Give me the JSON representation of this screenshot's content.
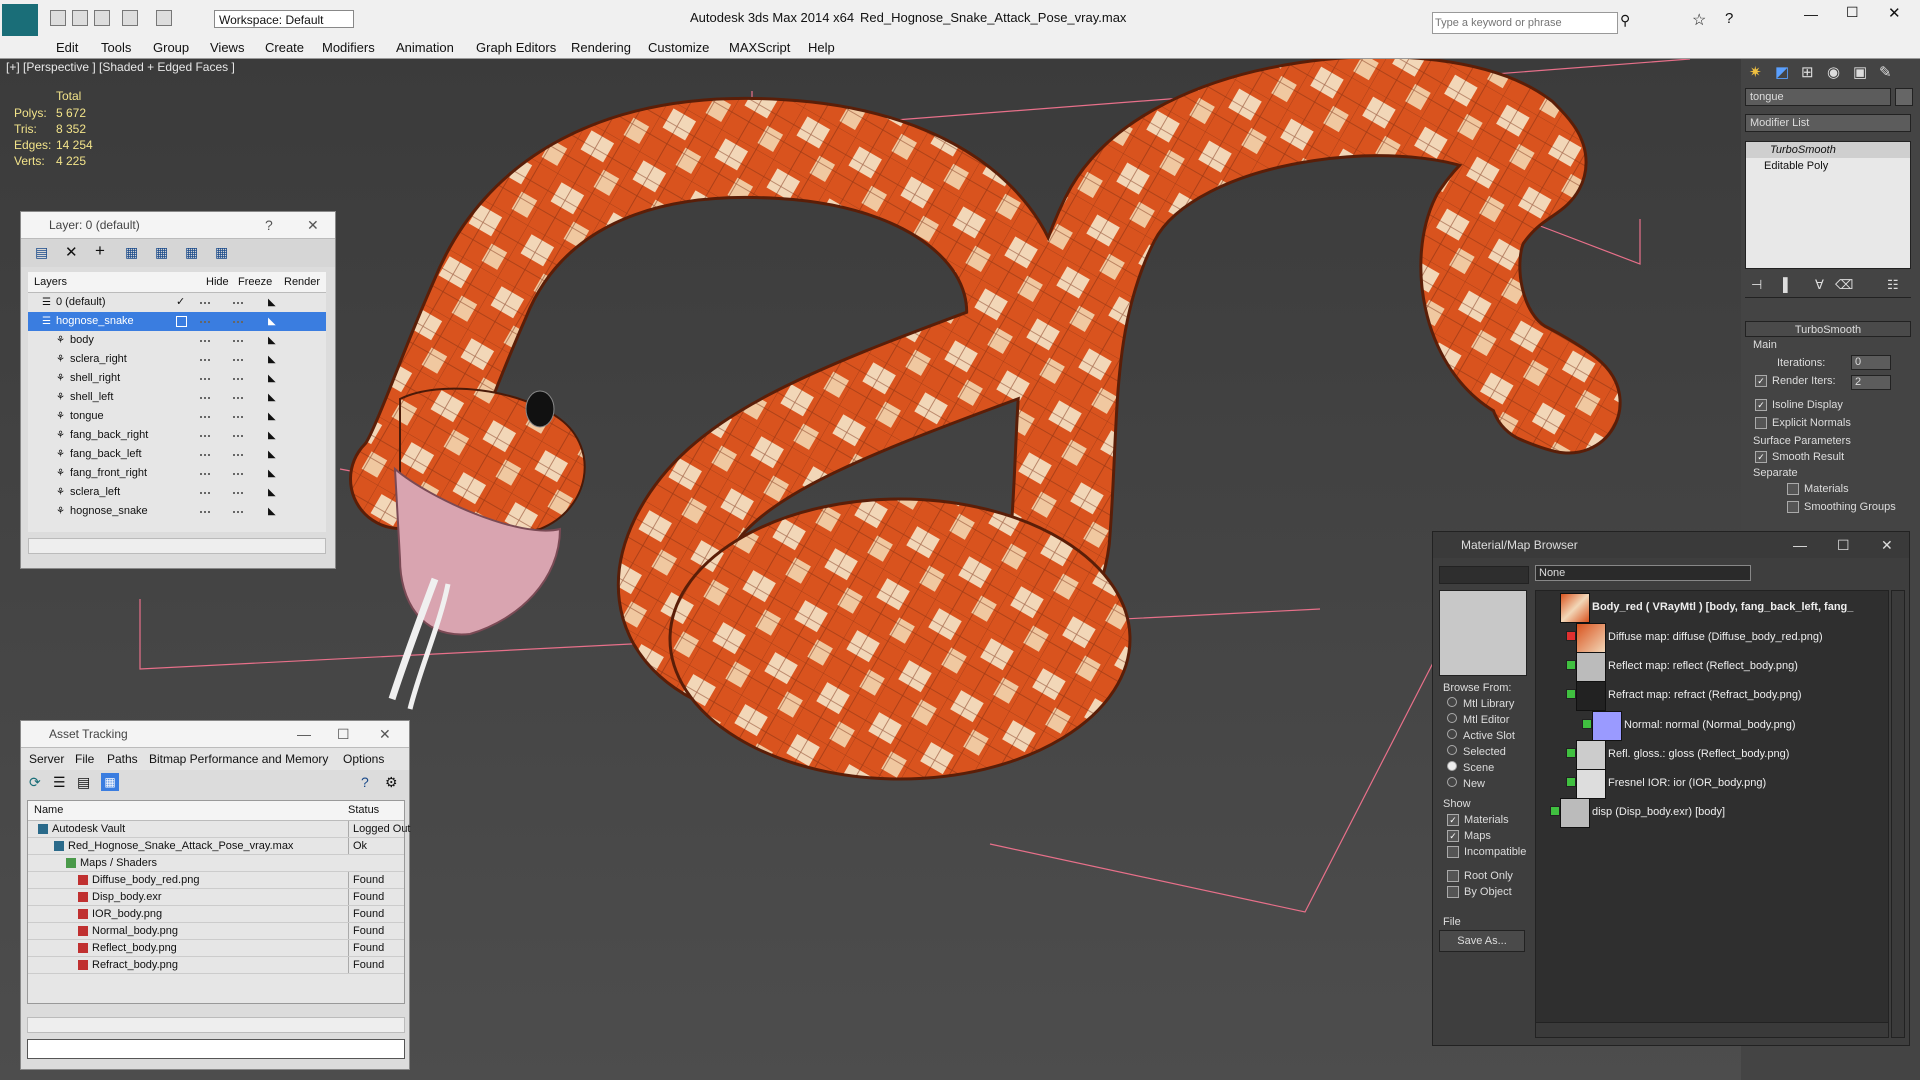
{
  "app": {
    "title": "Autodesk 3ds Max  2014 x64",
    "filename": "Red_Hognose_Snake_Attack_Pose_vray.max",
    "workspace": "Workspace: Default",
    "search_placeholder": "Type a keyword or phrase"
  },
  "menu": [
    "Edit",
    "Tools",
    "Group",
    "Views",
    "Create",
    "Modifiers",
    "Animation",
    "Graph Editors",
    "Rendering",
    "Customize",
    "MAXScript",
    "Help"
  ],
  "viewport": {
    "label": "[+] [Perspective ] [Shaded + Edged Faces ]",
    "stats_header": "Total",
    "stats": [
      {
        "k": "Polys:",
        "v": "5 672"
      },
      {
        "k": "Tris:",
        "v": "8 352"
      },
      {
        "k": "Edges:",
        "v": "14 254"
      },
      {
        "k": "Verts:",
        "v": "4 225"
      }
    ]
  },
  "layers": {
    "title": "Layer: 0 (default)",
    "help": "?",
    "close": "✕",
    "col_layers": "Layers",
    "col_hide": "Hide",
    "col_freeze": "Freeze",
    "col_render": "Render",
    "items": [
      "0 (default)",
      "hognose_snake",
      "body",
      "sclera_right",
      "shell_right",
      "shell_left",
      "tongue",
      "fang_back_right",
      "fang_back_left",
      "fang_front_right",
      "sclera_left",
      "hognose_snake"
    ]
  },
  "asset": {
    "title": "Asset Tracking",
    "menu": [
      "Server",
      "File",
      "Paths",
      "Bitmap Performance and Memory",
      "Options"
    ],
    "col_name": "Name",
    "col_status": "Status",
    "rows": [
      {
        "name": "Autodesk Vault",
        "status": "Logged Out"
      },
      {
        "name": "Red_Hognose_Snake_Attack_Pose_vray.max",
        "status": "Ok"
      },
      {
        "name": "Maps / Shaders",
        "status": ""
      },
      {
        "name": "Diffuse_body_red.png",
        "status": "Found"
      },
      {
        "name": "Disp_body.exr",
        "status": "Found"
      },
      {
        "name": "IOR_body.png",
        "status": "Found"
      },
      {
        "name": "Normal_body.png",
        "status": "Found"
      },
      {
        "name": "Reflect_body.png",
        "status": "Found"
      },
      {
        "name": "Refract_body.png",
        "status": "Found"
      }
    ]
  },
  "cmd": {
    "object_name": "tongue",
    "modifier_list": "Modifier List",
    "stack": [
      "TurboSmooth",
      "Editable Poly"
    ],
    "rollout": "TurboSmooth",
    "main": "Main",
    "iterations_label": "Iterations:",
    "iterations": "0",
    "render_iters_label": "Render Iters:",
    "render_iters": "2",
    "isoline": "Isoline Display",
    "explicit": "Explicit Normals",
    "surface": "Surface Parameters",
    "smooth": "Smooth Result",
    "separate": "Separate",
    "materials": "Materials",
    "smoothing": "Smoothing Groups"
  },
  "mmb": {
    "title": "Material/Map Browser",
    "search": "None",
    "browse_from": "Browse From:",
    "browse": [
      "Mtl Library",
      "Mtl Editor",
      "Active Slot",
      "Selected",
      "Scene",
      "New"
    ],
    "show": "Show",
    "show_items": [
      "Materials",
      "Maps",
      "Incompatible"
    ],
    "root_only": "Root Only",
    "by_object": "By Object",
    "file": "File",
    "save_as": "Save As...",
    "tree": [
      "Body_red  ( VRayMtl )  [body, fang_back_left, fang_",
      "Diffuse map: diffuse (Diffuse_body_red.png)",
      "Reflect map: reflect (Reflect_body.png)",
      "Refract map: refract (Refract_body.png)",
      "Normal: normal (Normal_body.png)",
      "Refl. gloss.: gloss (Reflect_body.png)",
      "Fresnel IOR: ior (IOR_body.png)",
      "disp (Disp_body.exr)  [body]"
    ]
  },
  "colors": {
    "accent": "#3a7de0",
    "snake_orange": "#d9531e",
    "snake_cream": "#f2d7b8"
  }
}
